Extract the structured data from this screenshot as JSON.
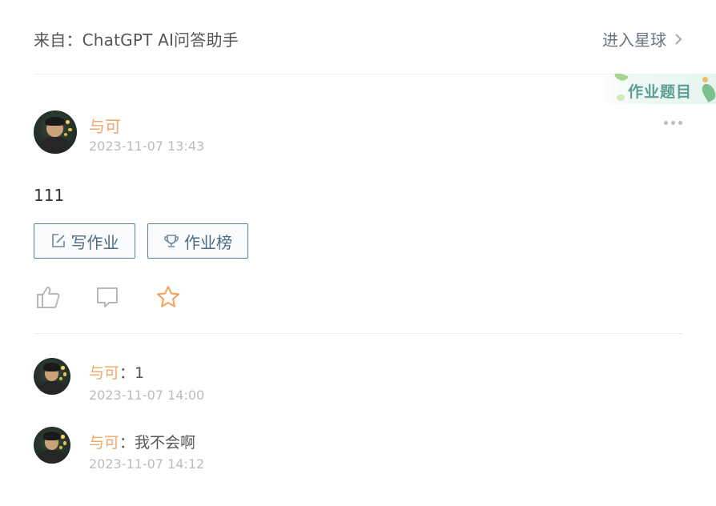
{
  "header": {
    "source": "来自：ChatGPT AI问答助手",
    "enter_label": "进入星球"
  },
  "badge": {
    "label": "作业题目"
  },
  "post": {
    "author": "与可",
    "time": "2023-11-07 13:43",
    "content": "111",
    "write_label": "写作业",
    "rank_label": "作业榜"
  },
  "actions": {
    "like_icon": "thumbs-up-icon",
    "comment_icon": "comment-icon",
    "star_icon": "star-icon",
    "star_color": "#f5a05a"
  },
  "comments": [
    {
      "author": "与可",
      "separator": "：",
      "text": "1",
      "time": "2023-11-07 14:00"
    },
    {
      "author": "与可",
      "separator": "：",
      "text": "我不会啊",
      "time": "2023-11-07 14:12"
    }
  ],
  "colors": {
    "accent_name": "#f0a868",
    "button_border": "#5c7d98",
    "muted": "#b9bdc2"
  }
}
